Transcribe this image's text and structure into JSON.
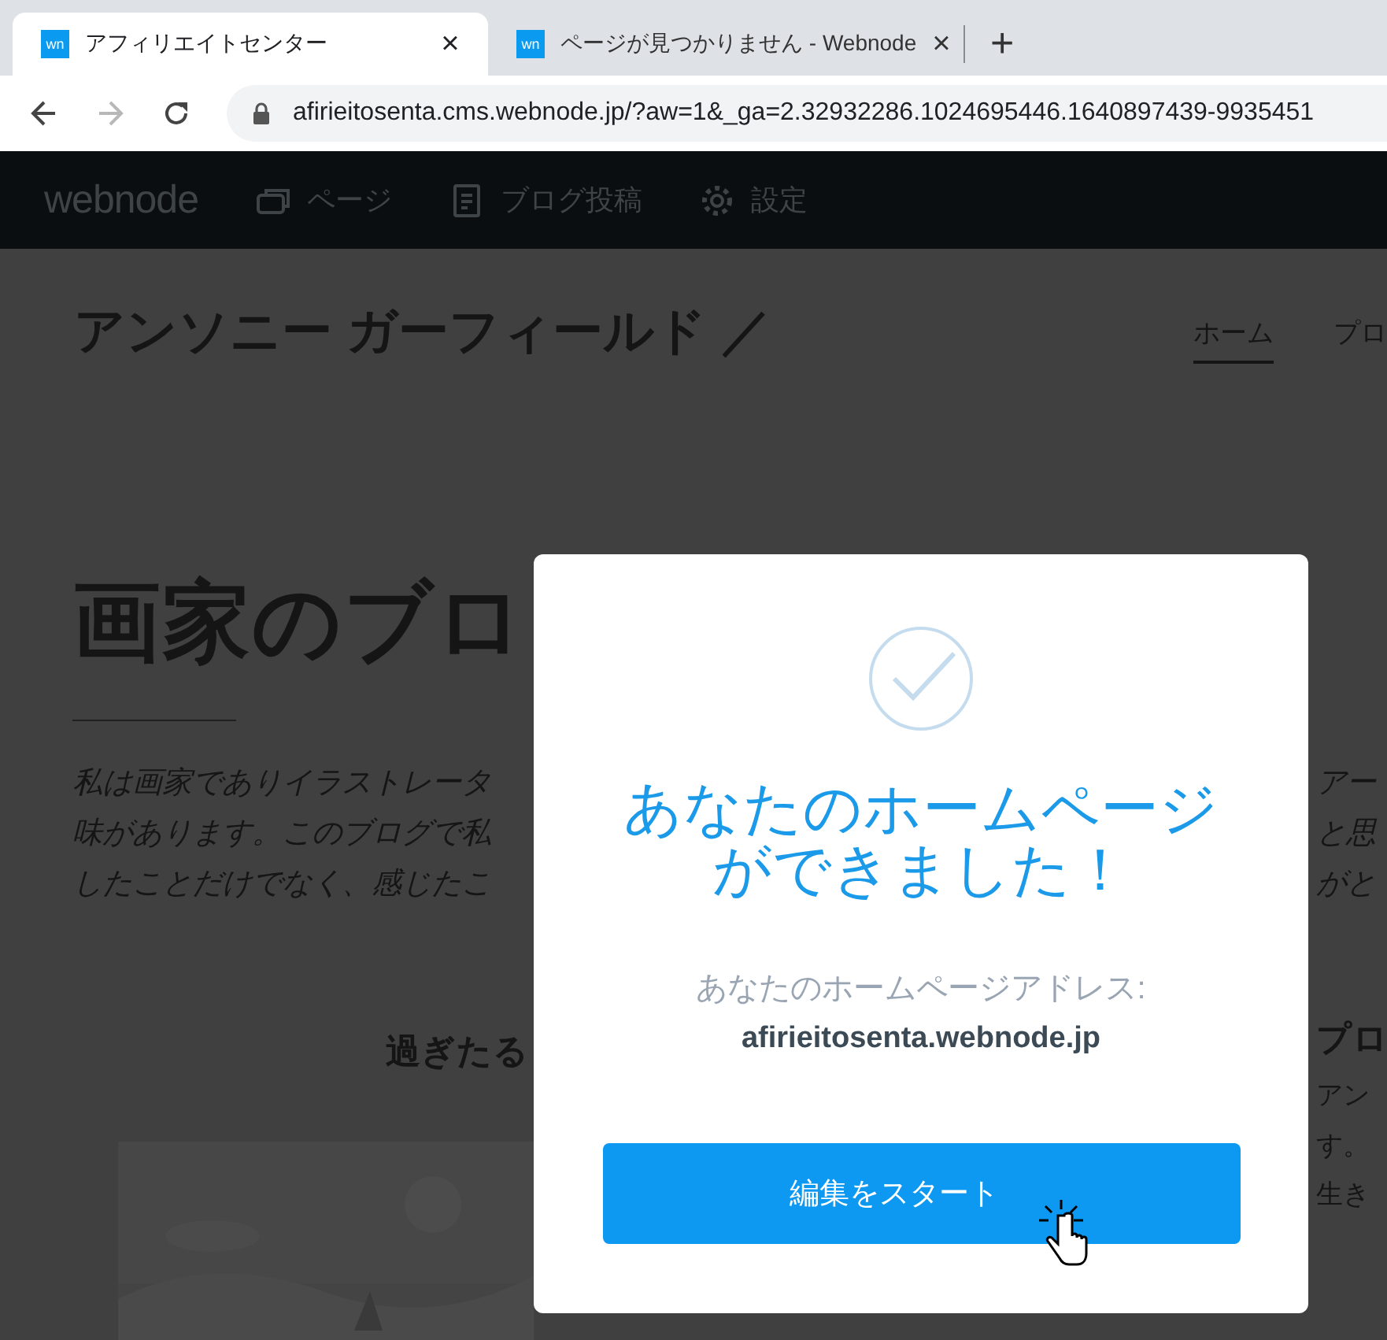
{
  "browser": {
    "tabs": [
      {
        "favicon": "wn",
        "title": "アフィリエイトセンター",
        "close": "×",
        "selected": true
      },
      {
        "favicon": "wn",
        "title": "ページが見つかりません - Webnode",
        "close": "×",
        "selected": false
      }
    ],
    "new_tab": "+",
    "forward_disabled": true,
    "url": "afirieitosenta.cms.webnode.jp/?aw=1&_ga=2.32932286.1024695446.1640897439-9935451"
  },
  "editor_bar": {
    "logo": "webnode",
    "menu": [
      {
        "kind": "pages",
        "label": "ページ"
      },
      {
        "kind": "blog",
        "label": "ブログ投稿"
      },
      {
        "kind": "settings",
        "label": "設定"
      }
    ]
  },
  "site": {
    "title": "アンソニー ガーフィールド ／",
    "nav": [
      {
        "label": "ホーム",
        "selected": true
      },
      {
        "label": "プロ",
        "selected": false
      }
    ],
    "heading": "画家のブロ",
    "intro_lines": [
      "私は画家でありイラストレータ",
      "味があります。このブログで私",
      "したことだけでなく、感じたこ"
    ],
    "intro_right": [
      "アー",
      "と思",
      "がと"
    ],
    "post_title": "過ぎたる",
    "side_title": "プロ",
    "side_lines": [
      "アン",
      "す。",
      "生き"
    ]
  },
  "dialog": {
    "title_lines": [
      "あなたのホームページ",
      "ができました！"
    ],
    "address_label": "あなたのホームページアドレス:",
    "address": "afirieitosenta.webnode.jp",
    "button": "編集をスタート"
  }
}
